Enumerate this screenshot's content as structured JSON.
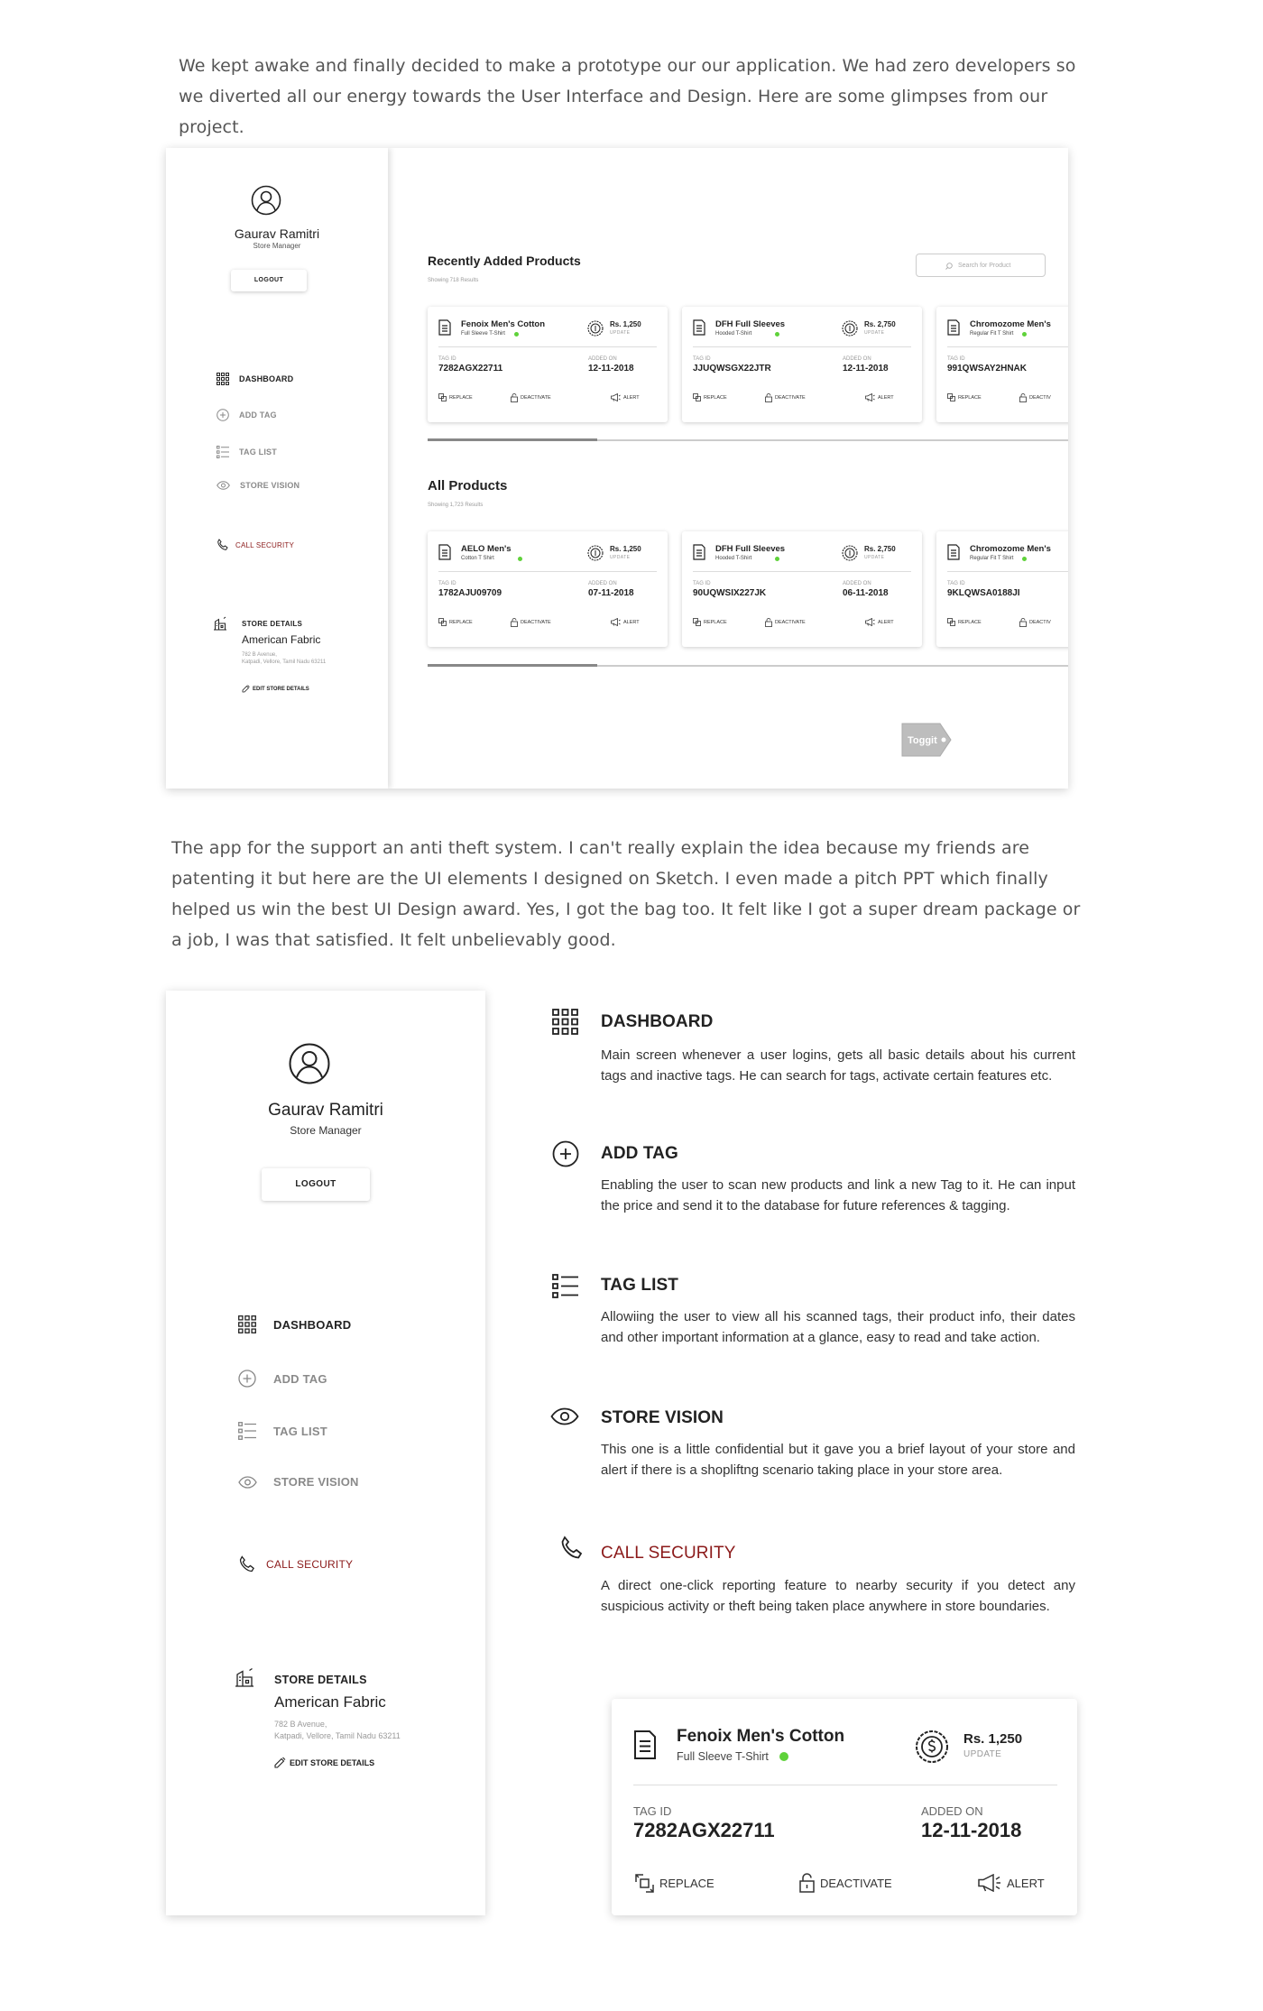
{
  "intro": {
    "paragraph1": "We kept awake and finally decided to make a prototype our our application. We had zero developers so we diverted all our energy towards the User Interface and Design. Here are some glimpses from our project.",
    "paragraph2": "The app for the support an anti theft system. I can't really explain the idea because my friends are patenting it but here are the UI elements I designed on Sketch. I even made a pitch PPT which finally helped us win the best UI Design award. Yes, I got the bag too. It felt like I got a super dream package or a job, I was that satisfied. It felt unbelievably good."
  },
  "profile": {
    "name": "Gaurav Ramitri",
    "role": "Store Manager",
    "logout_label": "LOGOUT"
  },
  "nav": {
    "dashboard": "DASHBOARD",
    "add_tag": "ADD TAG",
    "tag_list": "TAG LIST",
    "store_vision": "STORE VISION",
    "call_security": "CALL SECURITY"
  },
  "store": {
    "title": "STORE DETAILS",
    "name": "American Fabric",
    "address_line1": "782 B Avenue,",
    "address_line2": "Katpadi, Vellore, Tamil Nadu 63211",
    "edit_label": "EDIT STORE DETAILS"
  },
  "recent": {
    "title": "Recently Added Products",
    "subtitle": "Showing 718 Results",
    "search_placeholder": "Search for Product",
    "cards": [
      {
        "name": "Fenoix Men's Cotton",
        "sub": "Full Sleeve T-Shirt",
        "price": "Rs. 1,250",
        "tag_id": "7282AGX22711",
        "added_on": "12-11-2018"
      },
      {
        "name": "DFH Full Sleeves",
        "sub": "Hooded T-Shirt",
        "price": "Rs. 2,750",
        "tag_id": "JJUQWSGX22JTR",
        "added_on": "12-11-2018"
      },
      {
        "name": "Chromozome Men's",
        "sub": "Regular Fit T Shirt",
        "price": "",
        "tag_id": "991QWSAY2HNAK",
        "added_on": ""
      }
    ]
  },
  "all": {
    "title": "All Products",
    "subtitle": "Showing 1,723 Results",
    "cards": [
      {
        "name": "AELO Men's",
        "sub": "Cotton T Shirt",
        "price": "Rs. 1,250",
        "tag_id": "1782AJU09709",
        "added_on": "07-11-2018"
      },
      {
        "name": "DFH Full Sleeves",
        "sub": "Hooded T-Shirt",
        "price": "Rs. 2,750",
        "tag_id": "90UQWSIX227JK",
        "added_on": "06-11-2018"
      },
      {
        "name": "Chromozome Men's",
        "sub": "Regular Fit T Shirt",
        "price": "",
        "tag_id": "9KLQWSA0188JI",
        "added_on": ""
      }
    ]
  },
  "card_labels": {
    "update": "UPDATE",
    "tag_id": "TAG ID",
    "added_on": "ADDED ON",
    "replace": "REPLACE",
    "deactivate": "DEACTIVATE",
    "deactive_cut": "DEACTIV",
    "alert": "ALERT"
  },
  "brand": {
    "toggit": "Toggit"
  },
  "features": [
    {
      "icon": "grid-icon",
      "title": "DASHBOARD",
      "desc": "Main screen whenever a user logins, gets all basic details about his current tags and inactive tags. He can search for tags, activate certain features etc."
    },
    {
      "icon": "plus-circle-icon",
      "title": "ADD TAG",
      "desc": "Enabling the user to scan new products and link a new Tag to it. He can input the price and send it to the database for future references & tagging."
    },
    {
      "icon": "list-icon",
      "title": "TAG LIST",
      "desc": "Allowiing the user to view all his scanned tags, their product info, their dates and other important information at a glance, easy to read and take action."
    },
    {
      "icon": "eye-icon",
      "title": "STORE VISION",
      "desc": "This one is a little confidential but it gave you a brief layout of your store and alert if there is a shopliftng scenario taking place in your store area."
    },
    {
      "icon": "phone-icon",
      "title": "CALL SECURITY",
      "desc": "A direct one-click reporting feature to nearby security if you detect any suspicious activity or theft being taken place anywhere in store boundaries."
    }
  ],
  "big_card": {
    "name": "Fenoix Men's Cotton",
    "sub": "Full Sleeve T-Shirt",
    "price": "Rs. 1,250",
    "tag_id": "7282AGX22711",
    "added_on": "12-11-2018"
  },
  "colors": {
    "accent_red": "#8b1a1a",
    "status_green": "#5fd23a"
  }
}
